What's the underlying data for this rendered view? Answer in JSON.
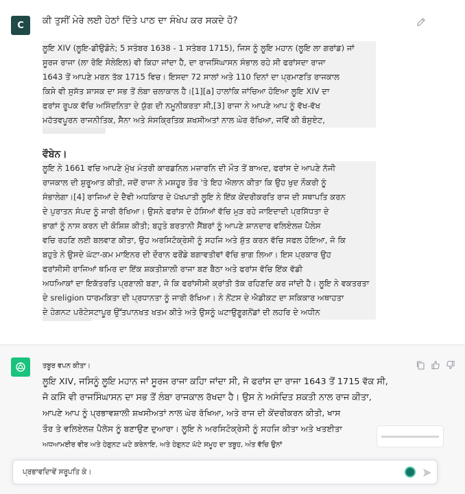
{
  "user": {
    "avatar_letter": "C",
    "question": "ਕੀ ਤੁਸੀਂ ਮੇਰੇ ਲਈ ਹੇਠਾਂ ਦਿੱਤੇ ਪਾਠ ਦਾ ਸੰਖੇਪ ਕਰ ਸਕਦੇ ਹੋ?",
    "paragraph1": [
      "ਲੂਇ XIV (ਲੂਇ-ਡੀਉਡੋਨੇ; 5 ਸਤੰਬਰ 1638 - 1 ਸਤੰਬਰ 1715), ਜਿਸ ਨੂੰ ਲੂਇ ਮਹਾਨ (ਲੂਇ ਲਾ ਗਰਾਂਡ) ਜਾਂ",
      "ਸੂਰਜ ਰਾਜਾ (ਲਾ ਰੋਇ ਸੋਲੇਇਲ) ਵੀ ਕਿਹਾ ਜਾਂਦਾ ਹੈ, ਦਾ ਰਾਜਸਿੰਘਾਸਨ ਸੰਭਾਲ ਰਹੇ ਸੀ ਫਰਾਂਸਦਾ ਰਾਜਾ",
      "1643 ਤੋਂ ਆਪਣੇ ਮਰਨ ਤੱਕ 1715 ਵਿਚ। ਇਸਦਾ 72 ਸਾਲਾਂ ਅਤੇ 110 ਦਿਨਾਂ ਦਾ ਪ੍ਰਮਾਣਤਿ ਰਾਜਕਾਲ",
      "ਕਿਸੇ ਵੀ ਸੁਸੱਤ ਸ਼ਾਸਕ ਦਾ ਸਭ ਤੋਂ ਲੰਬਾ ਚਲਾਕਾਲ ਹੈ।[1][a] ਹਾਲਾਂਕਿ ਜਾਂਚਿਆ ਹੋਇਆ ਲੂਇ XIV ਦਾ",
      "ਫਰਾਂਸ ਰੂਪਕ ਵੱਚਿ ਅਸਿੰਦਨਿਤਾ ਦੇ ਯੁੱਗ ਦੀ ਨਮੂਨੀਕਰਤਾ ਸੀ,[3] ਰਾਜਾ ਨੇ ਆਪਣੇ ਆਪ ਨੂੰ ਵੱਖ-ਵੱਖ",
      "ਮਹੱਤਵਪੂਰਨ ਰਾਜਨੀਤਿਕ, ਸੈਨਾ ਅਤੇ ਸੰਸਕ੍ਰਿਤਿਕ ਸ਼ਖਸੀਅਤਾਂ ਨਾਲ ਘੇਰ ਰੱਖਿਆ, ਜਵਿੇਂ ਕੀ ਬੋਸੁਏਟ,"
    ],
    "heading": "ਵੌਬੇਨ।",
    "paragraph2": [
      "ਲੂਇ ਨੇ 1661 ਵਚਿ ਆਪਣੇ ਮੁੱਖ ਮੰਤਰੀ ਕਾਰਡਨਿਲ ਮਜ਼ਾਰਨਿ ਦੀ ਮੌਤ ਤੋਂ ਬਾਅਦ, ਫਰਾਂਸ ਦੇ ਆਪਣੇ ਨੱਜੀ",
      "ਰਾਜਕਾਲ ਦੀ ਸ਼ੁਰੂਆਤ ਕੀਤੀ, ਜਦੋਂ ਰਾਜਾ ਨੇ ਮਸ਼ਹੂਰ ਤੌਰ 'ਤੇ ਇਹ ਐਲਾਨ ਕੀਤਾ ਕਿ ਉਹ ਖੁਦ ਨੌਕਰੀ ਨੂੰ",
      "ਸੰਭਾਲੇਗਾ।[4] ਰਾਜਿਆਂ ਦੇ ਦੈਵੀ ਅਧਕਿਾਰ ਦੇ ਪੱਖਪਾਤੀ ਲੂਇ ਨੇ ਇੱਕ ਕੇਂਦਰੀਕਰਤਿ ਰਾਜ ਦੀ ਸਥਾਪਤਿ ਕਰਨ",
      "ਦੇ ਪੁਰਾਤਨ ਸੰਪਦ ਨੂੰ ਜਾਰੀ ਰੱਖਿਆ। ਉਸਨੇ ਫਰਾਂਸ ਦੇ ਹੱਸਿਆਂ ਵੱਚਿ ਮੁੜ ਰਹੇ ਜਾਇਦਾਦੀ ਪ੍ਰਸਿੱਧਤਾ ਦੇ",
      "ਭਾਗਾਂ ਨੂੰ ਨਾਸ ਕਰਨ ਦੀ ਕੋਸ਼ਿਸ਼ ਕੀਤੀ; ਬਹੁਤੇ ਬਰਤਾਨੀ ਸੈਂਬਰਾਂ ਨੂੰ ਆਪਣੇ ਸ਼ਾਨਦਾਰ ਵਲਿਏਲਜ਼ ਪੈਲੇਸ",
      "ਵਚਿ ਰਹਣਿ ਲਈ ਬਲਵਾਣ ਕੀਤਾ, ਉਹ ਅਰਸਿਟੋਕ੍ਰੇਸੀ ਨੂੰ ਸਹਜਿ ਅਤੇ ਸ਼ੁੱਤ ਕਰਨ ਵੱਚਿ ਸਫਲ ਹੋਇਆ, ਜੋ ਕਿ",
      "ਬਹੁਤੇ ਨੇ ਉਸਦੇ ਘੱਟਾ-ਕਮ ਮਾਇਨਰ ਦੀ ਦੌਰਾਨ ਫਰੌਂਡੇ ਬਗਾਵਤੀਵਾਂ ਵੱਚਿ ਭਾਗ ਲਿਆ। ਇਸ ਪ੍ਰਕਾਰ ਉਹ",
      "ਫਰਾਂਸੀਸੀ ਰਾਜਿਆਂ ਥਮਿਰ ਦਾ ਇੱਕ ਸ਼ਕਤੀਸ਼ਾਲੀ ਰਾਜਾ ਬਣ ਬੈਠਾ ਅਤੇ ਫਰਾਂਸ ਵੱਚਿ ਇੱਕ ਵੱਡੀ",
      "ਅਧਆਿਕਾਂ ਦਾ ਇਕੱਤਰਤਿ ਪ੍ਰਣਾਲੀ ਬਣਾ, ਜੋ ਕਿ ਫਰਾਂਸੀਸੀ ਕ੍ਰਾਂਤੀ ਤੱਕ ਰਹਿਣਦਿ ਕਰ ਜਾਂਦੀ ਹੈ। ਲੂਇ ਨੇ ਵਕਤਰਤਾ",
      "ਦੇ sreligion ਧਾਰਮਕਿਤਾ ਦੀ ਪ੍ਰਧਾਨਤਾ ਨੂੰ ਜਾਰੀ ਰੱਖਿਆ। ਨੇ ਨੋਂਟਸ ਦੇ ਐਡੀਕਟ ਦਾ ਸਕਿਕਾਰ ਅਥਾਹਤਾ",
      "ਦੇ ਹੇਗੁਨਟ ਪ੍ਰੋਟੇਸਟਾਪੂਰ ਉੱਤਪਾਨਖਤ ਖਤਮ ਕੀਤੇ ਅਤੇ ਉਸਨੂੰ ਘਟਾਉਣੂਗਨੋਂਡਾਂ ਦੀ ਲਹਰਿ ਦੇ ਅਧੀਨ"
    ]
  },
  "assistant": {
    "lines": [
      "ਤਬੂਰ ਵਪਨ ਕੀਤਾ।",
      "ਲੂਇ XIV, ਜਸਿਨੂੰ ਲੂਇ ਮਹਾਨ ਜਾਂ ਸੂਰਜ ਰਾਜਾ ਕਹਿਾ ਜਾਂਦਾ ਸੀ, ਜੋ ਫਰਾਂਸ ਦਾ ਰਾਜਾ 1643 ਤੋਂ 1715 ਵੱਕ ਸੀ,",
      "ਜੋ ਕਸਿੇ ਵੀ ਰਾਜਸਿੰਘਾਸਨ ਦਾ ਸਭ ਤੋਂ ਲੰਬਾ ਰਾਜਕਾਲ ਰੱਖਦਾ ਹੈ। ਉਸ ਨੇ ਅਸੰਦਿਤ ਸ਼ਕਤੀ ਨਾਲ ਰਾਜ ਕੀਤਾ,",
      "ਆਪਣੇ ਆਪ ਨੂੰ ਪ੍ਰਭਾਵਸ਼ਾਲੀ ਸ਼ਖਸੀਅਤਾਂ ਨਾਲ ਘੇਰ ਰੱਖਿਆ, ਅਤੇ ਰਾਜ ਦੀ ਕੇਂਦਰੀਕਰਨ ਕੀਤੀ, ਖਾਸ",
      "ਤੌਰ ਤੇ ਵਲਿਏਲਜ਼ ਪੈਲੇਸ ਨੂੰ ਬਣਾਉਣ ਦੁਆਰਾ। ਲੂਇ ਨੇ ਅਰਸਿਟੋਕ੍ਰੇਸੀ ਨੂੰ ਸਹਜਿ ਕੀਤਾ ਅਤੇ ਖਤਈਤਾ",
      "ਅਧਆਮਈਰ ਵੀਰ ਅਤੇ ਹੇਗੁਨਟ ਘਟੇ ਕਰੇਨਾਇ, ਅਤੇ ਹੇਗੁਨਟ ਘੱਟੇ ਸਮੂਹ ਦਾ ਤਬੂਹ, ਅੰਤ ਵੱਚਿ ਉਨਾਂ"
    ]
  },
  "composer": {
    "text": "ਪ੍ਰਭਾਵਦਾਿਵੇਂ ਸਰੂਪਤਿ ਕੇ।"
  },
  "icons": {
    "edit": "pencil-edit-icon",
    "copy": "copy-icon",
    "thumbs_up": "thumbs-up-icon",
    "thumbs_down": "thumbs-down-icon",
    "send": "send-icon",
    "assistant_logo": "openai-logo-icon"
  },
  "colors": {
    "user_avatar": "#1f4a45",
    "assistant_avatar": "#19c37d",
    "assistant_bg": "#f7f7f8"
  }
}
